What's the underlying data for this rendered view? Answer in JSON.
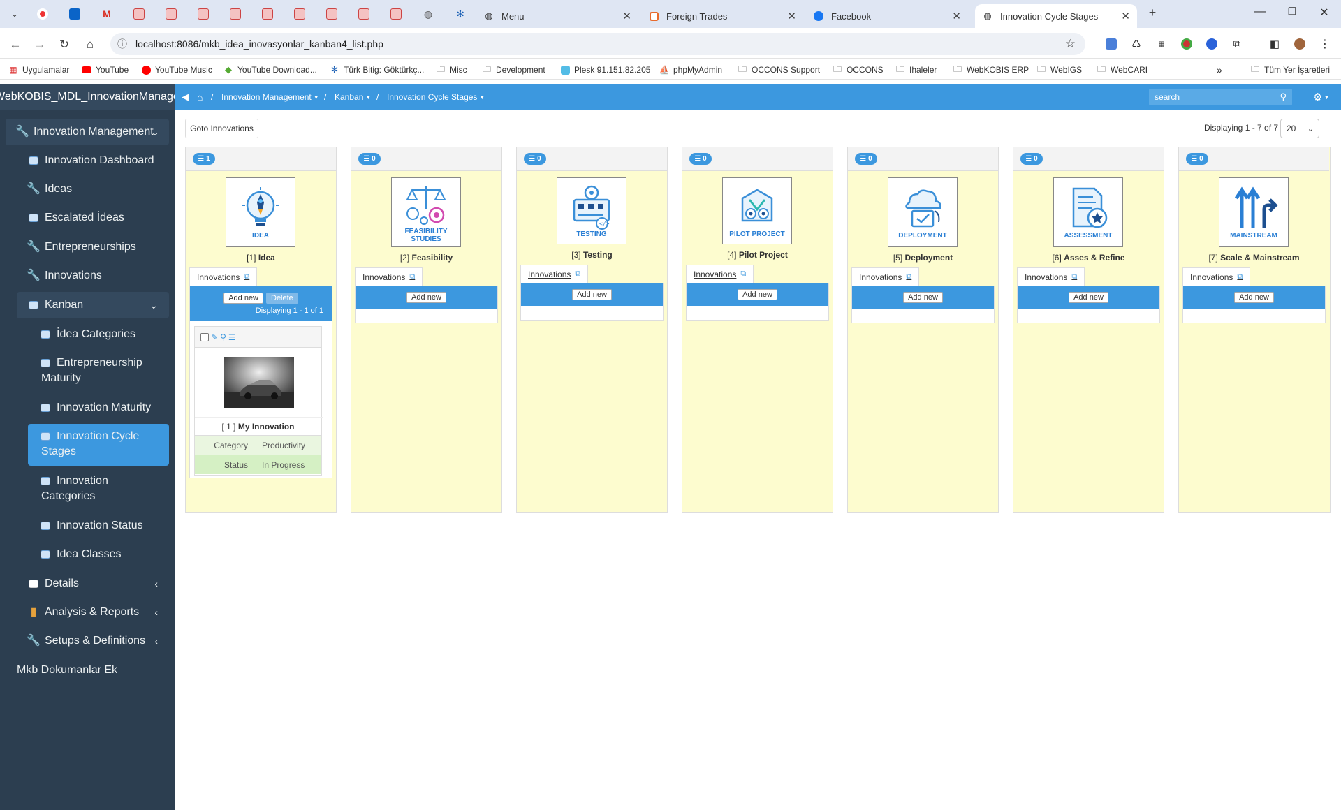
{
  "browser": {
    "tabs": [
      {
        "title": "Menu"
      },
      {
        "title": "Foreign Trades"
      },
      {
        "title": "Facebook"
      },
      {
        "title": "Innovation Cycle Stages"
      }
    ],
    "url": "localhost:8086/mkb_idea_inovasyonlar_kanban4_list.php",
    "bookmarks": [
      "Uygulamalar",
      "YouTube",
      "YouTube Music",
      "YouTube Download...",
      "Türk Bitig: Göktürkç...",
      "Misc",
      "Development",
      "Plesk 91.151.82.205",
      "phpMyAdmin",
      "OCCONS Support",
      "OCCONS",
      "Ihaleler",
      "WebKOBIS ERP",
      "WebIGS",
      "WebCARI"
    ],
    "all_bookmarks": "Tüm Yer İşaretleri"
  },
  "sidebar": {
    "app_title": "WebKOBIS_MDL_InnovationManagement",
    "menu": [
      {
        "label": "Innovation Management"
      },
      {
        "label": "Innovation Dashboard"
      },
      {
        "label": "Ideas"
      },
      {
        "label": "Escalated İdeas"
      },
      {
        "label": "Entrepreneurships"
      },
      {
        "label": "Innovations"
      },
      {
        "label": "Kanban"
      },
      {
        "label": "İdea Categories"
      },
      {
        "label": "Entrepreneurship Maturity"
      },
      {
        "label": "Innovation Maturity"
      },
      {
        "label": "Innovation Cycle Stages"
      },
      {
        "label": "Innovation Categories"
      },
      {
        "label": "Innovation Status"
      },
      {
        "label": "Idea Classes"
      },
      {
        "label": "Details"
      },
      {
        "label": "Analysis & Reports"
      },
      {
        "label": "Setups & Definitions"
      },
      {
        "label": "Mkb Dokumanlar Ek"
      }
    ]
  },
  "topnav": {
    "crumbs": [
      "Innovation Management",
      "Kanban",
      "Innovation Cycle Stages"
    ],
    "search_placeholder": "search"
  },
  "toolbar": {
    "goto_label": "Goto Innovations",
    "displaying": "Displaying 1 - 7 of 7",
    "page_size": "20"
  },
  "columns": [
    {
      "badge": "1",
      "caption": "IDEA",
      "num": "[1]",
      "name": "Idea"
    },
    {
      "badge": "0",
      "caption": "FEASIBILITY STUDIES",
      "num": "[2]",
      "name": "Feasibility"
    },
    {
      "badge": "0",
      "caption": "TESTING",
      "num": "[3]",
      "name": "Testing"
    },
    {
      "badge": "0",
      "caption": "PILOT PROJECT",
      "num": "[4]",
      "name": "Pilot Project"
    },
    {
      "badge": "0",
      "caption": "DEPLOYMENT",
      "num": "[5]",
      "name": "Deployment"
    },
    {
      "badge": "0",
      "caption": "ASSESSMENT",
      "num": "[6]",
      "name": "Asses & Refine"
    },
    {
      "badge": "0",
      "caption": "MAINSTREAM",
      "num": "[7]",
      "name": "Scale & Mainstream"
    }
  ],
  "column_labels": {
    "innovations_link": "Innovations",
    "add_new": "Add new",
    "delete": "Delete",
    "displaying": "Displaying 1 - 1 of 1"
  },
  "card": {
    "title_num": "[ 1 ]",
    "title": "My Innovation",
    "rows": [
      {
        "key": "Category",
        "value": "Productivity"
      },
      {
        "key": "Status",
        "value": "In Progress"
      }
    ]
  },
  "colors": {
    "accent": "#3c98df",
    "sidebar": "#2c3e50",
    "column_bg": "#fdfccf"
  }
}
